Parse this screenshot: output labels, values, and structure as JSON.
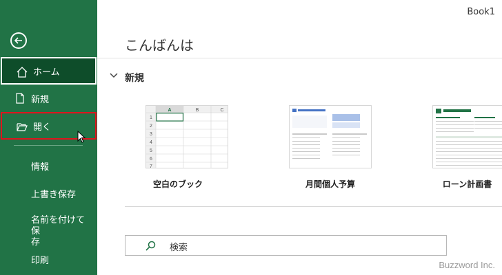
{
  "window": {
    "title": "Book1"
  },
  "sidebar": {
    "items": [
      {
        "label": "ホーム",
        "icon": "home-icon"
      },
      {
        "label": "新規",
        "icon": "new-document-icon"
      },
      {
        "label": "開く",
        "icon": "folder-open-icon"
      }
    ],
    "text_items": [
      "情報",
      "上書き保存",
      "名前を付けて保\n存",
      "印刷"
    ]
  },
  "main": {
    "greeting": "こんばんは",
    "section_title": "新規",
    "templates": [
      {
        "label": "空白のブック"
      },
      {
        "label": "月間個人予算"
      },
      {
        "label": "ローン計画書"
      }
    ],
    "blank_book_cols": [
      "A",
      "B",
      "C"
    ],
    "blank_book_rows": [
      "1",
      "2",
      "3",
      "4",
      "5",
      "6",
      "7"
    ],
    "search_placeholder": "検索"
  },
  "watermark": "Buzzword Inc.",
  "colors": {
    "sidebar": "#217346",
    "selected": "#0e4d2a",
    "focus_border": "#e0141d"
  }
}
